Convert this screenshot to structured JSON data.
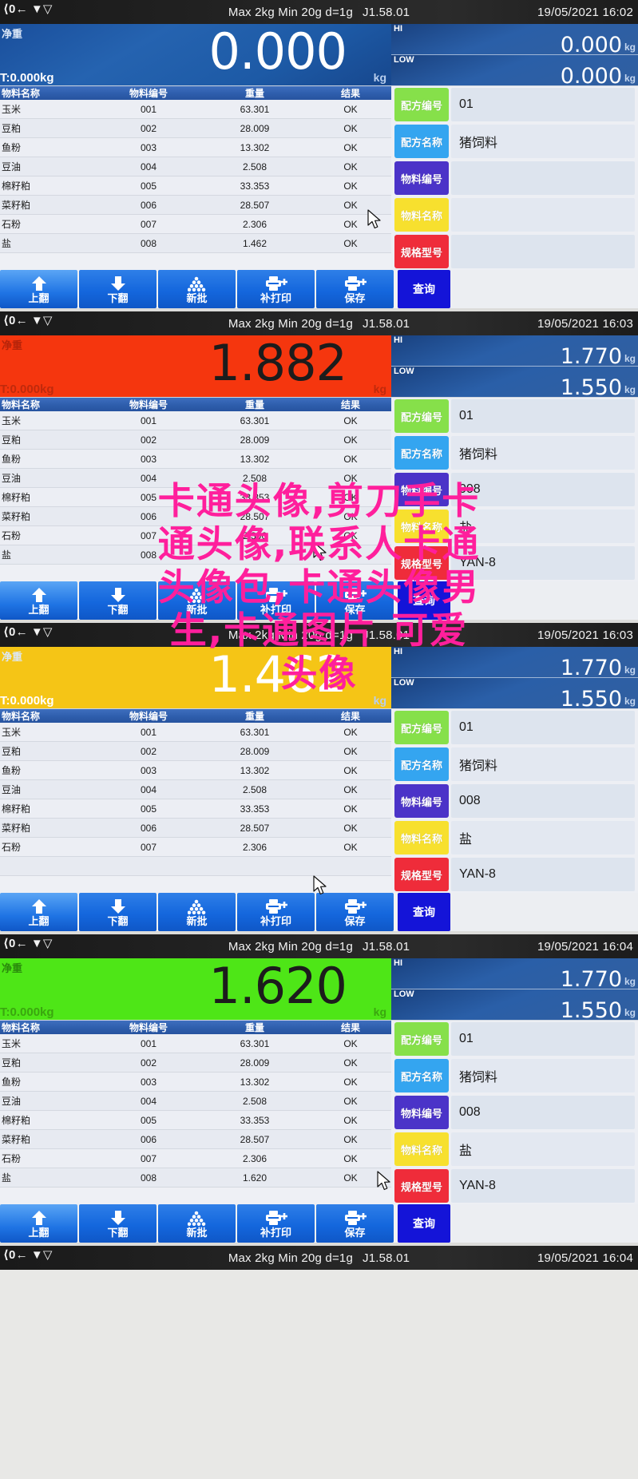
{
  "meta": {
    "table_headers": [
      "物料名称",
      "物料编号",
      "重量",
      "结果"
    ],
    "status_max": "Max 2kg",
    "status_min": "Min 20g",
    "status_d": "d=1g",
    "status_ver": "J1.58.01",
    "net_label": "净重",
    "unit_kg": "kg",
    "hi_label": "HI",
    "low_label": "LOW"
  },
  "buttons": [
    {
      "label": "上翻",
      "icon": "arrow-up-icon"
    },
    {
      "label": "下翻",
      "icon": "arrow-down-icon"
    },
    {
      "label": "新批",
      "icon": "stack-balls-icon"
    },
    {
      "label": "补打印",
      "icon": "printer-plus-icon"
    },
    {
      "label": "保存",
      "icon": "printer-plus-icon"
    }
  ],
  "query_button": {
    "label": "查询"
  },
  "sidebar_tags": [
    {
      "label": "配方编号",
      "color": "#86e04a"
    },
    {
      "label": "配方名称",
      "color": "#34a5f0"
    },
    {
      "label": "物料编号",
      "color": "#4b33c8"
    },
    {
      "label": "物料名称",
      "color": "#f7e02e"
    },
    {
      "label": "规格型号",
      "color": "#ef2c3a"
    }
  ],
  "panels": [
    {
      "id": "panel-1",
      "datetime": "19/05/2021  16:02",
      "display": {
        "mode": "blue",
        "net_label": "净重",
        "tare": "T:0.000kg",
        "value": "0.000",
        "unit": "kg"
      },
      "limits": {
        "hi": "0.000",
        "low": "0.000",
        "unit": "kg"
      },
      "rows": [
        {
          "name": "玉米",
          "code": "001",
          "weight": "63.301",
          "result": "OK"
        },
        {
          "name": "豆粕",
          "code": "002",
          "weight": "28.009",
          "result": "OK"
        },
        {
          "name": "鱼粉",
          "code": "003",
          "weight": "13.302",
          "result": "OK"
        },
        {
          "name": "豆油",
          "code": "004",
          "weight": "2.508",
          "result": "OK"
        },
        {
          "name": "棉籽粕",
          "code": "005",
          "weight": "33.353",
          "result": "OK"
        },
        {
          "name": "菜籽粕",
          "code": "006",
          "weight": "28.507",
          "result": "OK"
        },
        {
          "name": "石粉",
          "code": "007",
          "weight": "2.306",
          "result": "OK"
        },
        {
          "name": "盐",
          "code": "008",
          "weight": "1.462",
          "result": "OK"
        }
      ],
      "sidebar_values": [
        "01",
        "猪饲料",
        "",
        "",
        ""
      ]
    },
    {
      "id": "panel-2",
      "datetime": "19/05/2021  16:03",
      "display": {
        "mode": "red",
        "net_label": "净重",
        "tare": "T:0.000kg",
        "value": "1.882",
        "unit": "kg"
      },
      "limits": {
        "hi": "1.770",
        "low": "1.550",
        "unit": "kg"
      },
      "rows": [
        {
          "name": "玉米",
          "code": "001",
          "weight": "63.301",
          "result": "OK"
        },
        {
          "name": "豆粕",
          "code": "002",
          "weight": "28.009",
          "result": "OK"
        },
        {
          "name": "鱼粉",
          "code": "003",
          "weight": "13.302",
          "result": "OK"
        },
        {
          "name": "豆油",
          "code": "004",
          "weight": "2.508",
          "result": "OK"
        },
        {
          "name": "棉籽粕",
          "code": "005",
          "weight": "33.353",
          "result": "OK"
        },
        {
          "name": "菜籽粕",
          "code": "006",
          "weight": "28.507",
          "result": "OK"
        },
        {
          "name": "石粉",
          "code": "007",
          "weight": "2.306",
          "result": "OK"
        },
        {
          "name": "盐",
          "code": "008",
          "weight": "",
          "result": ""
        }
      ],
      "sidebar_values": [
        "01",
        "猪饲料",
        "008",
        "盐",
        "YAN-8"
      ]
    },
    {
      "id": "panel-3",
      "datetime": "19/05/2021  16:03",
      "display": {
        "mode": "yellow",
        "net_label": "净重",
        "tare": "T:0.000kg",
        "value": "1.462",
        "unit": "kg"
      },
      "limits": {
        "hi": "1.770",
        "low": "1.550",
        "unit": "kg"
      },
      "rows": [
        {
          "name": "玉米",
          "code": "001",
          "weight": "63.301",
          "result": "OK"
        },
        {
          "name": "豆粕",
          "code": "002",
          "weight": "28.009",
          "result": "OK"
        },
        {
          "name": "鱼粉",
          "code": "003",
          "weight": "13.302",
          "result": "OK"
        },
        {
          "name": "豆油",
          "code": "004",
          "weight": "2.508",
          "result": "OK"
        },
        {
          "name": "棉籽粕",
          "code": "005",
          "weight": "33.353",
          "result": "OK"
        },
        {
          "name": "菜籽粕",
          "code": "006",
          "weight": "28.507",
          "result": "OK"
        },
        {
          "name": "石粉",
          "code": "007",
          "weight": "2.306",
          "result": "OK"
        },
        {
          "name": "",
          "code": "",
          "weight": "",
          "result": ""
        }
      ],
      "sidebar_values": [
        "01",
        "猪饲料",
        "008",
        "盐",
        "YAN-8"
      ]
    },
    {
      "id": "panel-4",
      "datetime": "19/05/2021  16:04",
      "display": {
        "mode": "green",
        "net_label": "净重",
        "tare": "T:0.000kg",
        "value": "1.620",
        "unit": "kg"
      },
      "limits": {
        "hi": "1.770",
        "low": "1.550",
        "unit": "kg"
      },
      "rows": [
        {
          "name": "玉米",
          "code": "001",
          "weight": "63.301",
          "result": "OK"
        },
        {
          "name": "豆粕",
          "code": "002",
          "weight": "28.009",
          "result": "OK"
        },
        {
          "name": "鱼粉",
          "code": "003",
          "weight": "13.302",
          "result": "OK"
        },
        {
          "name": "豆油",
          "code": "004",
          "weight": "2.508",
          "result": "OK"
        },
        {
          "name": "棉籽粕",
          "code": "005",
          "weight": "33.353",
          "result": "OK"
        },
        {
          "name": "菜籽粕",
          "code": "006",
          "weight": "28.507",
          "result": "OK"
        },
        {
          "name": "石粉",
          "code": "007",
          "weight": "2.306",
          "result": "OK"
        },
        {
          "name": "盐",
          "code": "008",
          "weight": "1.620",
          "result": "OK"
        }
      ],
      "sidebar_values": [
        "01",
        "猪饲料",
        "008",
        "盐",
        "YAN-8"
      ]
    }
  ],
  "bottom_strip": {
    "datetime": "19/05/2021  16:04"
  },
  "watermark": {
    "color": "#ff1f9c",
    "lines": [
      "卡通头像,剪刀手卡",
      "通头像,联系人卡通",
      "头像包,卡通头像男",
      "生,卡通图片 可爱",
      "头像"
    ]
  }
}
